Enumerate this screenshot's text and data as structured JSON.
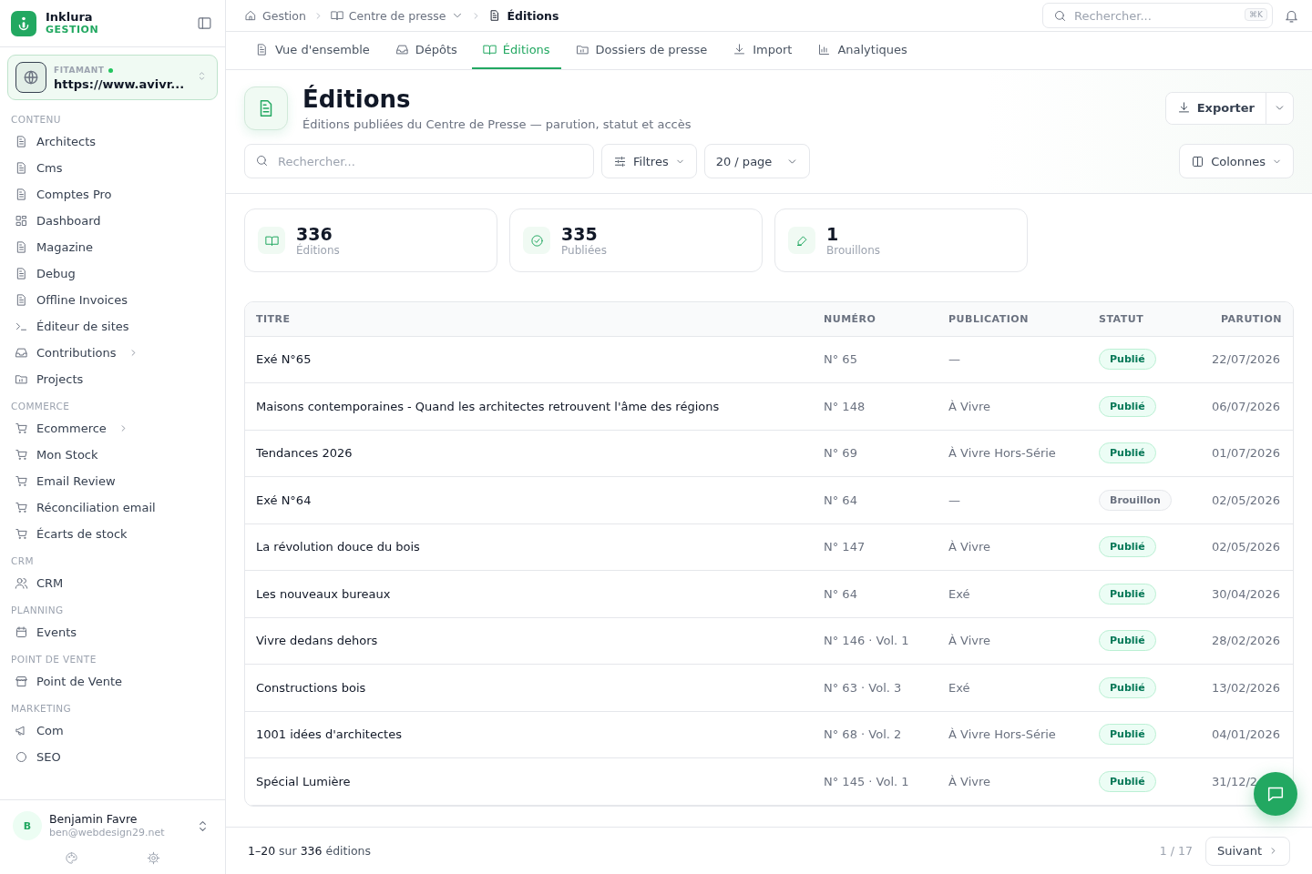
{
  "brand": {
    "name": "Inklura",
    "subtitle": "GESTION"
  },
  "workspace": {
    "label": "FITAMANT",
    "online": true,
    "url": "https://www.avivr..."
  },
  "sidebar": {
    "sections": [
      {
        "title": "CONTENU",
        "items": [
          {
            "label": "Architects",
            "has_children": false
          },
          {
            "label": "Cms",
            "has_children": false
          },
          {
            "label": "Comptes Pro",
            "has_children": false
          },
          {
            "label": "Dashboard",
            "has_children": false
          },
          {
            "label": "Magazine",
            "has_children": false
          },
          {
            "label": "Debug",
            "has_children": false
          },
          {
            "label": "Offline Invoices",
            "has_children": false
          },
          {
            "label": "Éditeur de sites",
            "has_children": false
          },
          {
            "label": "Contributions",
            "has_children": true
          },
          {
            "label": "Projects",
            "has_children": false
          }
        ]
      },
      {
        "title": "COMMERCE",
        "items": [
          {
            "label": "Ecommerce",
            "has_children": true
          },
          {
            "label": "Mon Stock",
            "has_children": false
          },
          {
            "label": "Email Review",
            "has_children": false
          },
          {
            "label": "Réconciliation email",
            "has_children": false
          },
          {
            "label": "Écarts de stock",
            "has_children": false
          }
        ]
      },
      {
        "title": "CRM",
        "items": [
          {
            "label": "CRM",
            "has_children": false
          }
        ]
      },
      {
        "title": "PLANNING",
        "items": [
          {
            "label": "Events",
            "has_children": false
          }
        ]
      },
      {
        "title": "POINT DE VENTE",
        "items": [
          {
            "label": "Point de Vente",
            "has_children": false
          }
        ]
      },
      {
        "title": "MARKETING",
        "items": [
          {
            "label": "Com",
            "has_children": false
          },
          {
            "label": "SEO",
            "has_children": false
          }
        ]
      }
    ]
  },
  "user": {
    "initial": "B",
    "name": "Benjamin Favre",
    "email": "ben@webdesign29.net"
  },
  "breadcrumb": [
    {
      "label": "Gestion",
      "dropdown": false,
      "current": false
    },
    {
      "label": "Centre de presse",
      "dropdown": true,
      "current": false
    },
    {
      "label": "Éditions",
      "dropdown": false,
      "current": true
    }
  ],
  "top_search": {
    "placeholder": "Rechercher...",
    "shortcut": "⌘K"
  },
  "tabs": [
    {
      "label": "Vue d'ensemble",
      "selected": false
    },
    {
      "label": "Dépôts",
      "selected": false
    },
    {
      "label": "Éditions",
      "selected": true
    },
    {
      "label": "Dossiers de presse",
      "selected": false
    },
    {
      "label": "Import",
      "selected": false
    },
    {
      "label": "Analytiques",
      "selected": false
    }
  ],
  "page": {
    "title": "Éditions",
    "subtitle": "Éditions publiées du Centre de Presse — parution, statut et accès",
    "export_button": "Exporter"
  },
  "toolbar": {
    "search_placeholder": "Rechercher...",
    "filters_button": "Filtres",
    "page_size": "20 / page",
    "columns_button": "Colonnes"
  },
  "stats": [
    {
      "value": "336",
      "label": "Éditions"
    },
    {
      "value": "335",
      "label": "Publiées"
    },
    {
      "value": "1",
      "label": "Brouillons"
    }
  ],
  "table": {
    "columns": [
      "TITRE",
      "NUMÉRO",
      "PUBLICATION",
      "STATUT",
      "PARUTION"
    ],
    "rows": [
      {
        "title": "Exé N°65",
        "number": "N° 65",
        "publication": "—",
        "status": {
          "label": "Publié",
          "kind": "published"
        },
        "date": "22/07/2026"
      },
      {
        "title": "Maisons contemporaines - Quand les architectes retrouvent l'âme des régions",
        "number": "N° 148",
        "publication": "À Vivre",
        "status": {
          "label": "Publié",
          "kind": "published"
        },
        "date": "06/07/2026"
      },
      {
        "title": "Tendances 2026",
        "number": "N° 69",
        "publication": "À Vivre Hors-Série",
        "status": {
          "label": "Publié",
          "kind": "published"
        },
        "date": "01/07/2026"
      },
      {
        "title": "Exé N°64",
        "number": "N° 64",
        "publication": "—",
        "status": {
          "label": "Brouillon",
          "kind": "draft"
        },
        "date": "02/05/2026"
      },
      {
        "title": "La révolution douce du bois",
        "number": "N° 147",
        "publication": "À Vivre",
        "status": {
          "label": "Publié",
          "kind": "published"
        },
        "date": "02/05/2026"
      },
      {
        "title": "Les nouveaux bureaux",
        "number": "N° 64",
        "publication": "Exé",
        "status": {
          "label": "Publié",
          "kind": "published"
        },
        "date": "30/04/2026"
      },
      {
        "title": "Vivre dedans dehors",
        "number": "N° 146 · Vol. 1",
        "publication": "À Vivre",
        "status": {
          "label": "Publié",
          "kind": "published"
        },
        "date": "28/02/2026"
      },
      {
        "title": "Constructions bois",
        "number": "N° 63 · Vol. 3",
        "publication": "Exé",
        "status": {
          "label": "Publié",
          "kind": "published"
        },
        "date": "13/02/2026"
      },
      {
        "title": "1001 idées d'architectes",
        "number": "N° 68 · Vol. 2",
        "publication": "À Vivre Hors-Série",
        "status": {
          "label": "Publié",
          "kind": "published"
        },
        "date": "04/01/2026"
      },
      {
        "title": "Spécial Lumière",
        "number": "N° 145 · Vol. 1",
        "publication": "À Vivre",
        "status": {
          "label": "Publié",
          "kind": "published"
        },
        "date": "31/12/2"
      }
    ]
  },
  "pagination": {
    "summary": "**1–20** sur **336** éditions",
    "page": "1 / 17",
    "next_button": "Suivant"
  }
}
